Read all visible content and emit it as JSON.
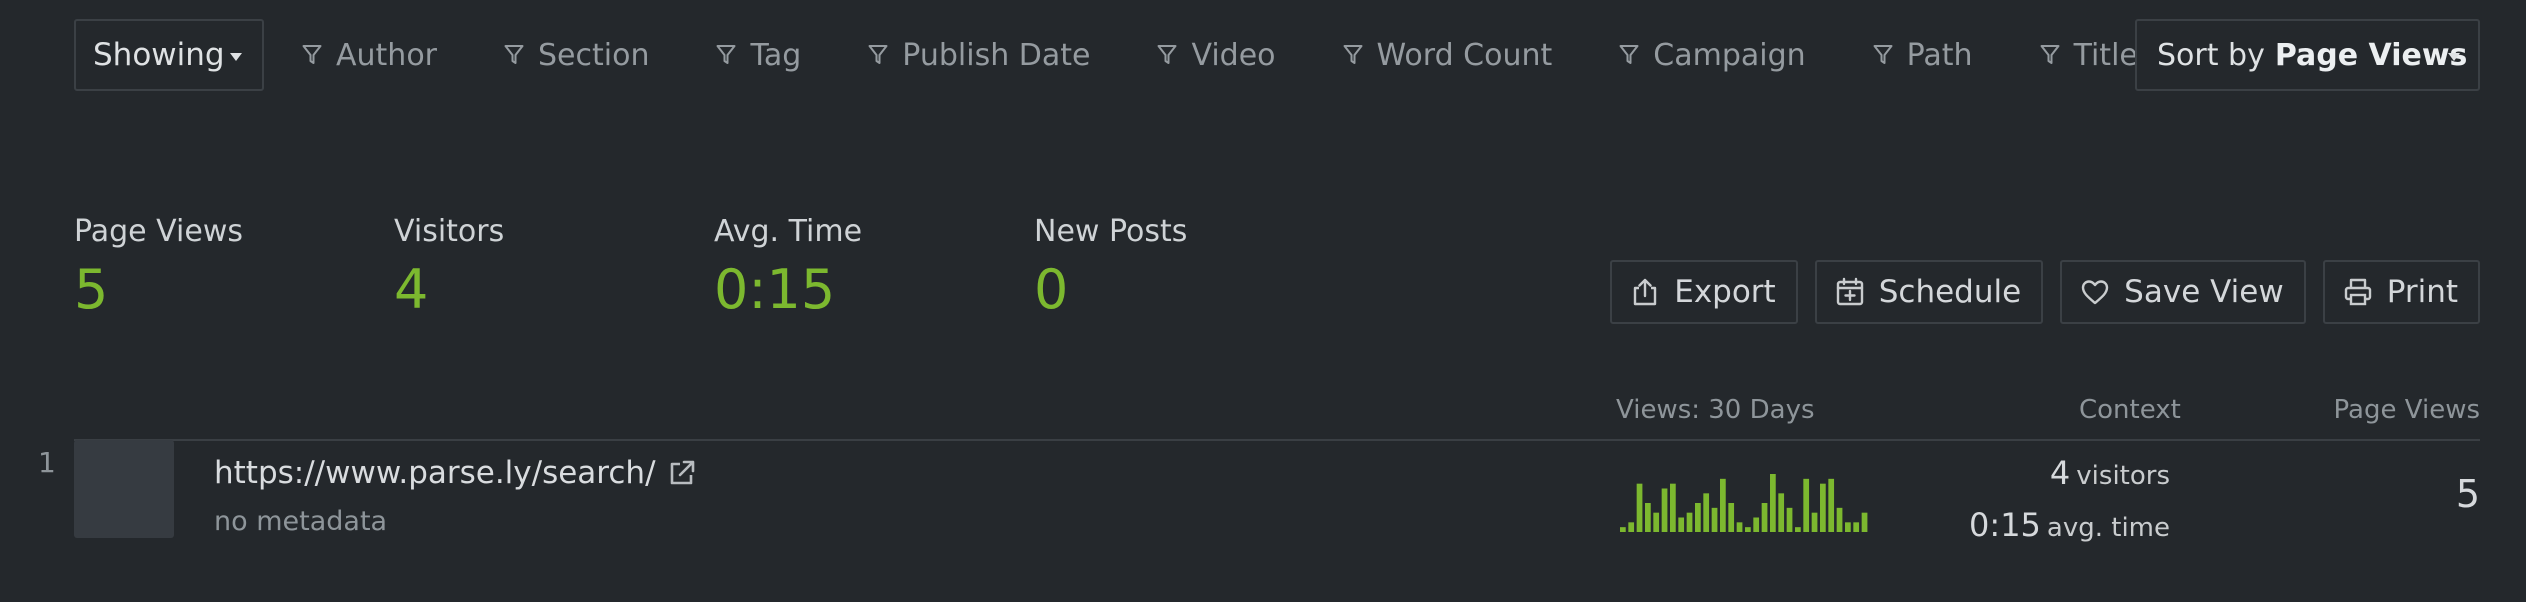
{
  "filter_bar": {
    "showing_label": "Showing",
    "filters": [
      "Author",
      "Section",
      "Tag",
      "Publish Date",
      "Video",
      "Word Count",
      "Campaign",
      "Path",
      "Title"
    ],
    "sort_prefix": "Sort by",
    "sort_value": "Page Views"
  },
  "metrics": {
    "page_views": {
      "label": "Page Views",
      "value": "5"
    },
    "visitors": {
      "label": "Visitors",
      "value": "4"
    },
    "avg_time": {
      "label": "Avg. Time",
      "value": "0:15"
    },
    "new_posts": {
      "label": "New Posts",
      "value": "0"
    }
  },
  "actions": {
    "export": "Export",
    "schedule": "Schedule",
    "save_view": "Save View",
    "print": "Print"
  },
  "table": {
    "headers": {
      "views_30_days": "Views: 30 Days",
      "context": "Context",
      "page_views": "Page Views"
    },
    "rows": [
      {
        "rank": "1",
        "url": "https://www.parse.ly/search/",
        "metadata": "no metadata",
        "visitors_count": "4",
        "visitors_label": "visitors",
        "avg_time": "0:15",
        "avg_time_label": "avg. time",
        "page_views": "5",
        "sparkline": [
          1,
          2,
          10,
          6,
          4,
          9,
          10,
          3,
          4,
          6,
          8,
          5,
          11,
          6,
          2,
          1,
          3,
          6,
          12,
          8,
          5,
          1,
          11,
          4,
          10,
          11,
          5,
          2,
          2,
          4
        ]
      }
    ]
  },
  "colors": {
    "background": "#24282c",
    "accent_green": "#7cb82f",
    "border": "#3b4045",
    "muted_text": "#959ba0"
  }
}
